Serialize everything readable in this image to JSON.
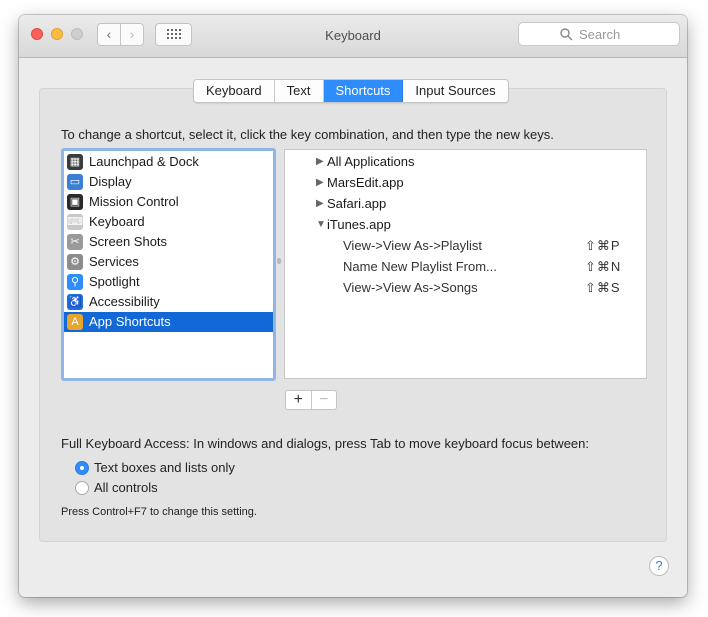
{
  "window": {
    "title": "Keyboard",
    "search_placeholder": "Search",
    "back_glyph": "‹",
    "forward_glyph": "›"
  },
  "tabs": [
    {
      "label": "Keyboard",
      "active": false
    },
    {
      "label": "Text",
      "active": false
    },
    {
      "label": "Shortcuts",
      "active": true
    },
    {
      "label": "Input Sources",
      "active": false
    }
  ],
  "instructions": "To change a shortcut, select it, click the key combination, and then type the new keys.",
  "categories": [
    {
      "label": "Launchpad & Dock",
      "icon": "launchpad-icon",
      "color": "#3b3b3b",
      "selected": false
    },
    {
      "label": "Display",
      "icon": "display-icon",
      "color": "#3a7fd5",
      "selected": false
    },
    {
      "label": "Mission Control",
      "icon": "mission-control-icon",
      "color": "#2a2a2a",
      "selected": false
    },
    {
      "label": "Keyboard",
      "icon": "keyboard-icon",
      "color": "#c8c8c8",
      "selected": false
    },
    {
      "label": "Screen Shots",
      "icon": "screenshot-icon",
      "color": "#9a9a9a",
      "selected": false
    },
    {
      "label": "Services",
      "icon": "gear-icon",
      "color": "#8c8c8c",
      "selected": false
    },
    {
      "label": "Spotlight",
      "icon": "spotlight-icon",
      "color": "#2f8dfb",
      "selected": false
    },
    {
      "label": "Accessibility",
      "icon": "accessibility-icon",
      "color": "#1e6fd9",
      "selected": false
    },
    {
      "label": "App Shortcuts",
      "icon": "app-shortcuts-icon",
      "color": "#e7a52d",
      "selected": true
    }
  ],
  "shortcuts": [
    {
      "type": "group",
      "label": "All Applications",
      "expanded": false
    },
    {
      "type": "group",
      "label": "MarsEdit.app",
      "expanded": false
    },
    {
      "type": "group",
      "label": "Safari.app",
      "expanded": false
    },
    {
      "type": "group",
      "label": "iTunes.app",
      "expanded": true
    },
    {
      "type": "item",
      "label": "View->View As->Playlist",
      "keys": "⇧⌘P"
    },
    {
      "type": "item",
      "label": "Name New Playlist From...",
      "keys": "⇧⌘N"
    },
    {
      "type": "item",
      "label": "View->View As->Songs",
      "keys": "⇧⌘S"
    }
  ],
  "buttons": {
    "add": "+",
    "remove": "−",
    "help": "?"
  },
  "full_keyboard_access": {
    "label": "Full Keyboard Access: In windows and dialogs, press Tab to move keyboard focus between:",
    "options": [
      {
        "label": "Text boxes and lists only",
        "selected": true
      },
      {
        "label": "All controls",
        "selected": false
      }
    ],
    "hint": "Press Control+F7 to change this setting."
  },
  "colors": {
    "accent": "#2f8dfb",
    "selection": "#1268d6",
    "focus_ring": "#8fb6e6"
  }
}
